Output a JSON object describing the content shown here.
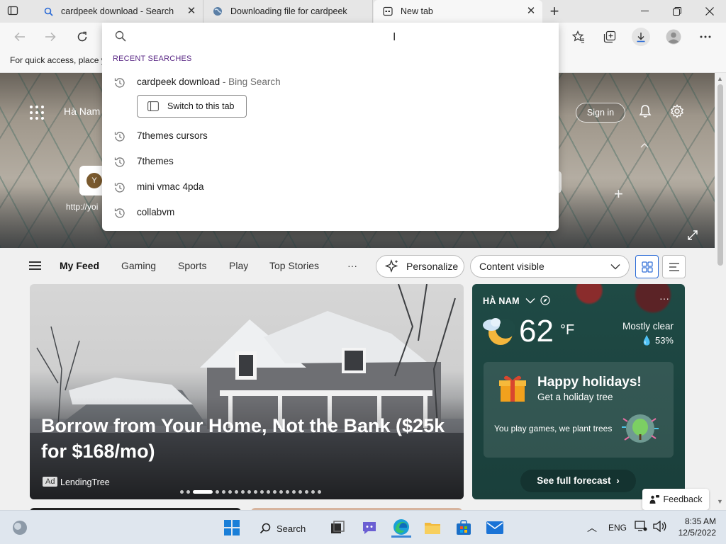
{
  "tabs": [
    {
      "title": "cardpeek download - Search",
      "icon": "search-icon",
      "active": false
    },
    {
      "title": "Downloading file for cardpeek",
      "icon": "globe-icon",
      "active": false
    },
    {
      "title": "New tab",
      "icon": "newtab-icon",
      "active": true
    }
  ],
  "favbar": {
    "text": "For quick access, place y"
  },
  "omnibox": {
    "value": "",
    "placeholder": "",
    "recent_header": "RECENT SEARCHES",
    "suggestions": [
      {
        "text": "cardpeek download",
        "suffix": " - Bing Search"
      },
      {
        "text": "7themes cursors"
      },
      {
        "text": "7themes"
      },
      {
        "text": "mini vmac 4pda"
      },
      {
        "text": "collabvm"
      }
    ],
    "switch_label": "Switch to this tab"
  },
  "hero": {
    "location": "Hà Nam",
    "signin": "Sign in",
    "quicklink_letter": "Y",
    "quicklink_label": "http://yoi"
  },
  "feednav": {
    "items": [
      "My Feed",
      "Gaming",
      "Sports",
      "Play",
      "Top Stories"
    ],
    "more": "···",
    "personalize": "Personalize",
    "content_visible": "Content visible"
  },
  "bigcard": {
    "headline": "Borrow from Your Home, Not the Bank ($25k for $168/mo)",
    "ad": "Ad",
    "source": "LendingTree"
  },
  "weather": {
    "location": "HÀ NAM",
    "temp": "62",
    "unit": "°F",
    "condition": "Mostly clear",
    "humidity": "53%",
    "holiday_title": "Happy holidays!",
    "holiday_sub": "Get a holiday tree",
    "holiday_play": "You play games, we plant trees",
    "forecast": "See full forecast"
  },
  "feedback": "Feedback",
  "taskbar": {
    "search": "Search",
    "lang": "ENG",
    "time": "8:35 AM",
    "date": "12/5/2022"
  },
  "colors": {
    "accent": "#2a6ad6",
    "weather_bg": "#1f4a45",
    "taskbar_bg": "#dfe6ee"
  }
}
